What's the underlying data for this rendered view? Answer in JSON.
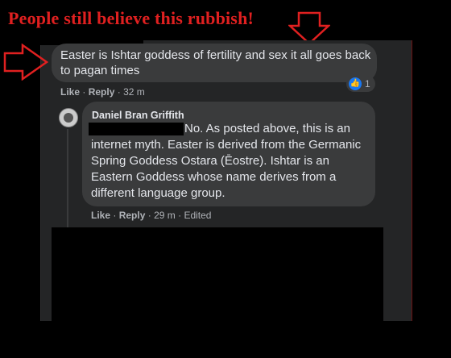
{
  "annotation": {
    "headline": "People still believe this rubbish!"
  },
  "comment1": {
    "text": "Easter is Ishtar goddess of fertility and sex it all goes back to pagan times",
    "like_label": "Like",
    "reply_label": "Reply",
    "time": "32 m",
    "reaction_count": "1"
  },
  "comment2": {
    "author": "Daniel Bran Griffith",
    "text": "No. As posted above, this is an internet myth. Easter is derived from the Germanic Spring Goddess Ostara (Ēostre). Ishtar is an Eastern Goddess whose name derives from a different language group.",
    "like_label": "Like",
    "reply_label": "Reply",
    "time": "29 m",
    "edited_label": "Edited"
  },
  "colors": {
    "annotation_red": "#e02020",
    "like_blue": "#1877f2"
  }
}
